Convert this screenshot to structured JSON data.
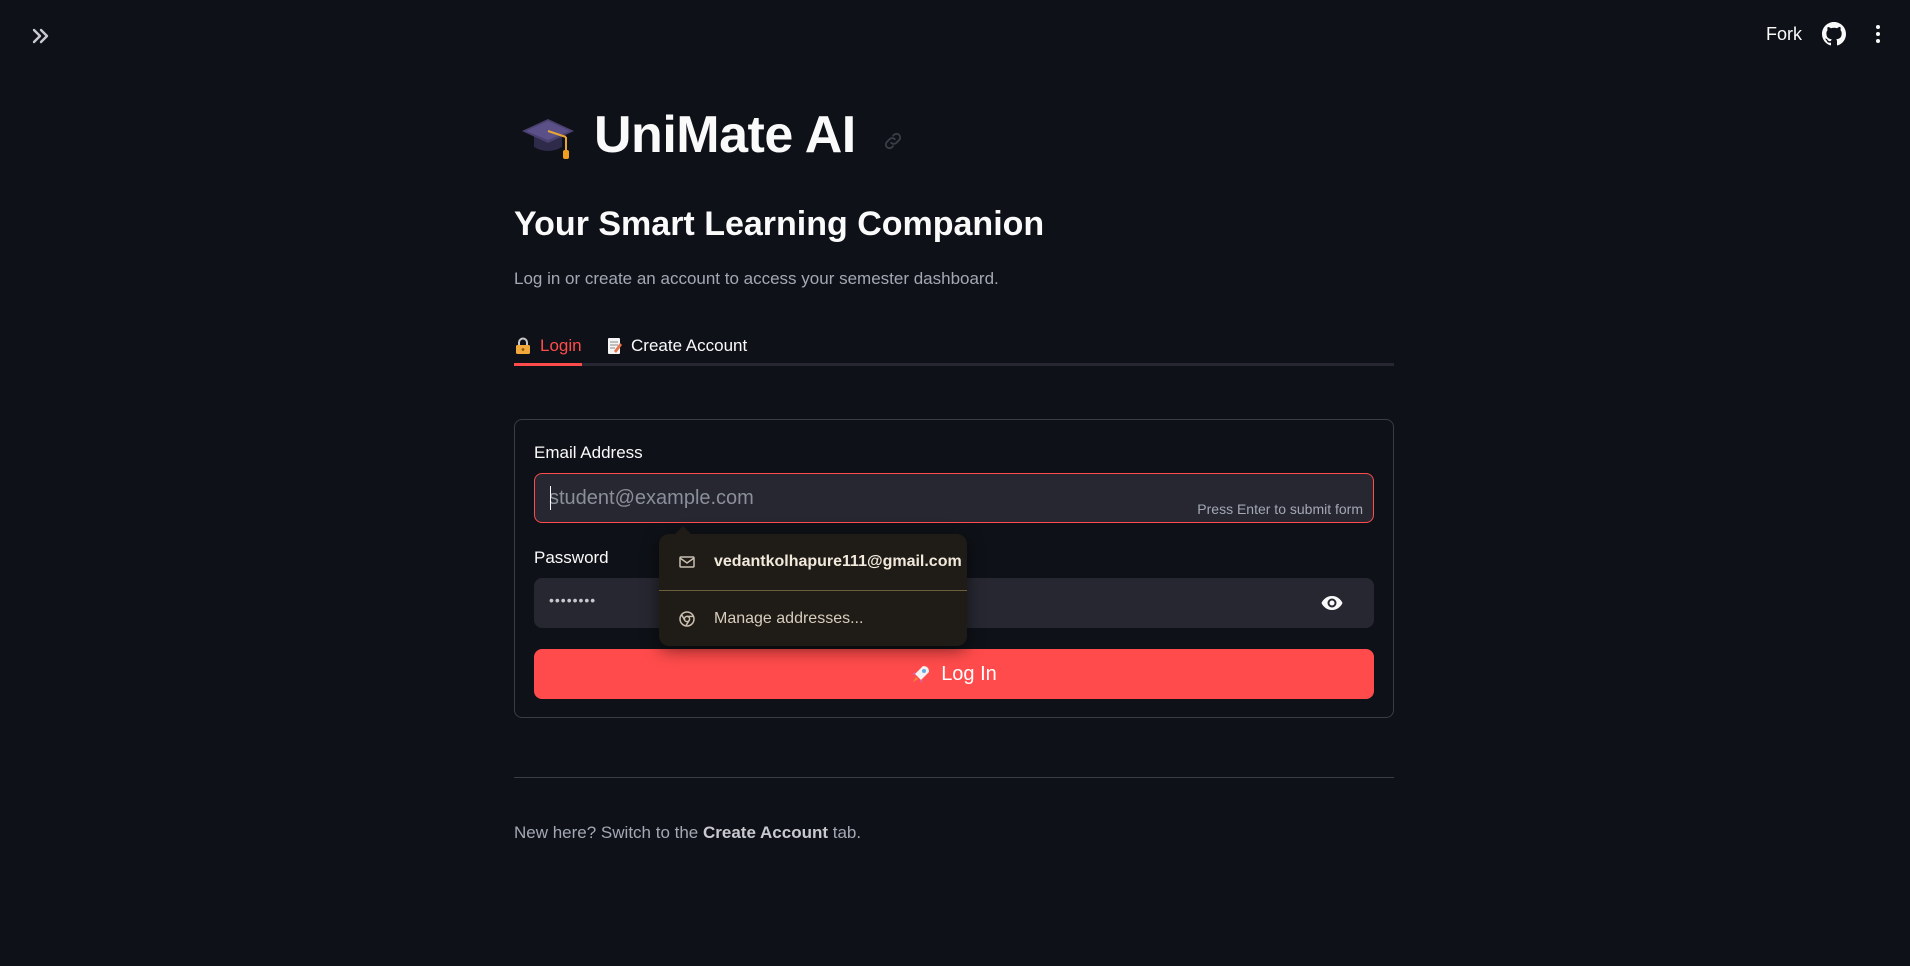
{
  "topbar": {
    "sidebar_toggle_icon": "double-chevron-right-icon",
    "fork_label": "Fork",
    "github_icon": "github-icon",
    "menu_icon": "kebab-menu-icon"
  },
  "header": {
    "title": "UniMate AI",
    "title_icon": "graduation-cap-icon",
    "subtitle": "Your Smart Learning Companion",
    "caption": "Log in or create an account to access your semester dashboard."
  },
  "tabs": [
    {
      "label": "Login",
      "icon": "lock-icon",
      "active": true
    },
    {
      "label": "Create Account",
      "icon": "memo-icon",
      "active": false
    }
  ],
  "login_form": {
    "email_label": "Email Address",
    "email_placeholder": "student@example.com",
    "email_value": "",
    "email_hint": "Press Enter to submit form",
    "password_label": "Password",
    "password_masked": "••••••••",
    "button_label": "Log In",
    "button_icon": "rocket-icon"
  },
  "autofill": {
    "suggestion": "vedantkolhapure111@gmail.com",
    "manage_label": "Manage addresses..."
  },
  "footer": {
    "prefix": "New here? Switch to the",
    "link": "Create Account",
    "suffix": "tab."
  },
  "colors": {
    "background": "#0e1117",
    "accent": "#ff4b4b",
    "input_background": "#262730"
  }
}
